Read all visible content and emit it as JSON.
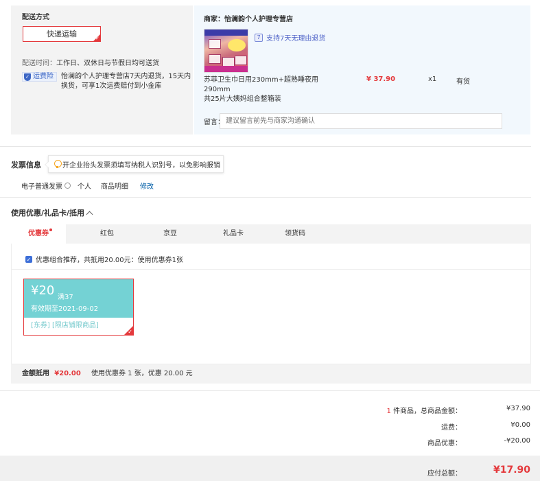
{
  "shipping": {
    "section_title": "配送方式",
    "method_label": "快递运输",
    "time_label": "配送时间：",
    "time_value": "工作日、双休日与节假日均可送货",
    "insurance_badge": "运费险",
    "insurance_text_line1": "怡澜韵个人护理专营店7天内退货，15天内",
    "insurance_text_line2": "换货，可享1次运费赔付到小金库"
  },
  "order": {
    "seller_label": "商家：",
    "seller_name": "怡澜韵个人护理专营店",
    "return_policy": "支持7天无理由退货",
    "product_title_line1": "苏菲卫生巾日用230mm+超熟睡夜用290mm",
    "product_title_line2": "共25片大姨妈组合整箱装",
    "price": "¥ 37.90",
    "quantity": "x1",
    "stock": "有货",
    "note_label": "留言：",
    "note_placeholder": "建议留言前先与商家沟通确认"
  },
  "invoice": {
    "section_title": "发票信息",
    "tip": "开企业抬头发票须填写纳税人识别号，以免影响报销",
    "type": "电子普通发票",
    "title": "个人",
    "content": "商品明细",
    "edit_link": "修改"
  },
  "discount": {
    "section_title": "使用优惠/礼品卡/抵用",
    "tabs": [
      "优惠券",
      "红包",
      "京豆",
      "礼品卡",
      "领货码"
    ],
    "recommend_text": "优惠组合推荐，共抵用20.00元：使用优惠券1张",
    "coupon": {
      "amount": "¥20",
      "condition": "满37",
      "validity": "有效期至2021-09-02",
      "tags": "[东券]  [限店铺限商品]"
    },
    "footer_label": "金额抵用",
    "footer_amount": "¥20.00",
    "footer_text": "使用优惠券 1 张，优惠 20.00 元"
  },
  "summary": {
    "item_count": "1",
    "items_label": "件商品，总商品金额：",
    "items_total": "¥37.90",
    "freight_label": "运费：",
    "freight_value": "¥0.00",
    "discount_label": "商品优惠：",
    "discount_value": "-¥20.00",
    "payable_label": "应付总额：",
    "payable_value": "¥17.90"
  },
  "colors": {
    "accent_red": "#e4393c",
    "coupon_teal": "#74d2d4",
    "link_blue": "#005ea7"
  }
}
